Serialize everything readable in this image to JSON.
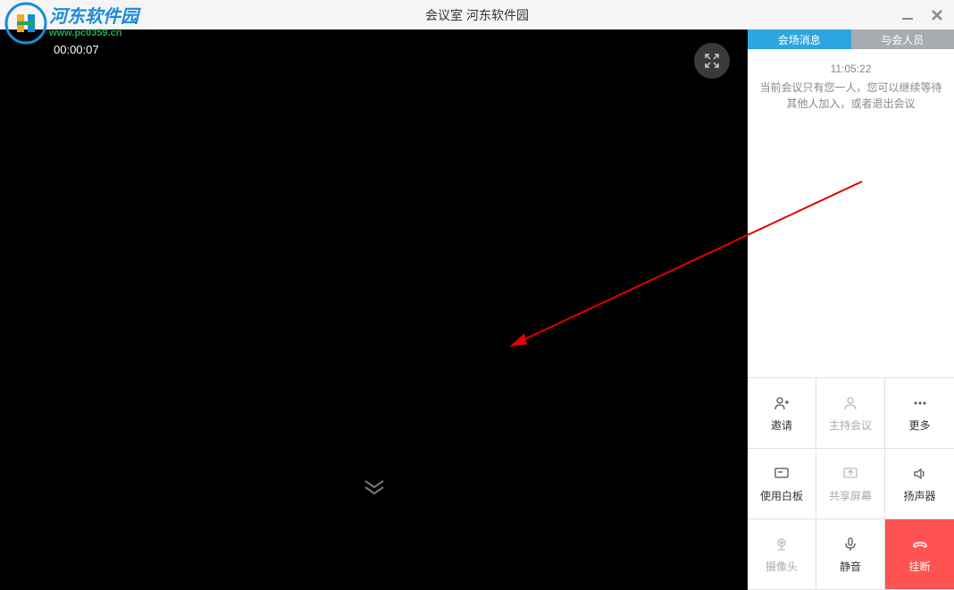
{
  "titlebar": {
    "title": "会议室 河东软件园"
  },
  "watermark": {
    "title": "河东软件园",
    "url": "www.pc0359.cn"
  },
  "video": {
    "timer": "00:00:07"
  },
  "sidebar": {
    "tabs": {
      "messages": "会场消息",
      "participants": "与会人员"
    },
    "message": {
      "time": "11:05:22",
      "text": "当前会议只有您一人，您可以继续等待其他人加入，或者退出会议"
    },
    "actions": {
      "invite": "邀请",
      "host": "主持会议",
      "more": "更多",
      "whiteboard": "使用白板",
      "share": "共享屏幕",
      "speaker": "扬声器",
      "camera": "摄像头",
      "mute": "静音",
      "hangup": "挂断"
    }
  }
}
